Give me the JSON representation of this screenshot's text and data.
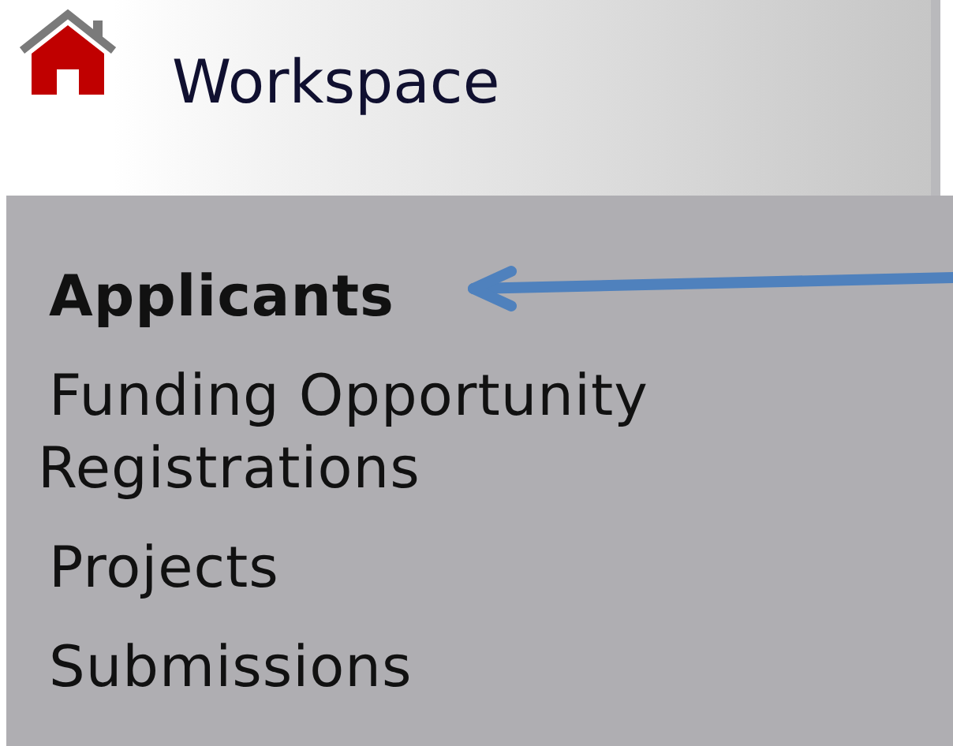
{
  "header": {
    "title": "Workspace"
  },
  "menu": {
    "items": [
      {
        "label": "Applicants",
        "selected": true
      },
      {
        "label": "Funding Opportunity Registrations",
        "selected": false
      },
      {
        "label": "Projects",
        "selected": false
      },
      {
        "label": "Submissions",
        "selected": false
      }
    ]
  }
}
